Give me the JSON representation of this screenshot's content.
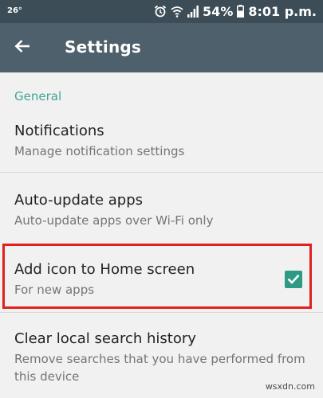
{
  "status_bar": {
    "temperature": "26°",
    "battery_percent": "54%",
    "time": "8:01 p.m."
  },
  "app_bar": {
    "title": "Settings"
  },
  "section": {
    "general_label": "General"
  },
  "settings": [
    {
      "title": "Notifications",
      "subtitle": "Manage notification settings"
    },
    {
      "title": "Auto-update apps",
      "subtitle": "Auto-update apps over Wi-Fi only"
    },
    {
      "title": "Add icon to Home screen",
      "subtitle": "For new apps",
      "checked": true
    },
    {
      "title": "Clear local search history",
      "subtitle_line1": "Remove searches that you have performed from",
      "subtitle_line2": "this device"
    }
  ],
  "watermark": "wsxdn.com",
  "colors": {
    "status_bar": "#3c4d57",
    "app_bar": "#4e606b",
    "accent": "#3fa693",
    "checkbox": "#2e9a85",
    "highlight": "#e0201f",
    "background": "#f1f1f1"
  },
  "icons": {
    "back": "back-arrow-icon",
    "alarm": "alarm-icon",
    "wifi": "wifi-icon",
    "signal": "signal-icon",
    "battery": "battery-icon",
    "check": "checkmark-icon"
  }
}
